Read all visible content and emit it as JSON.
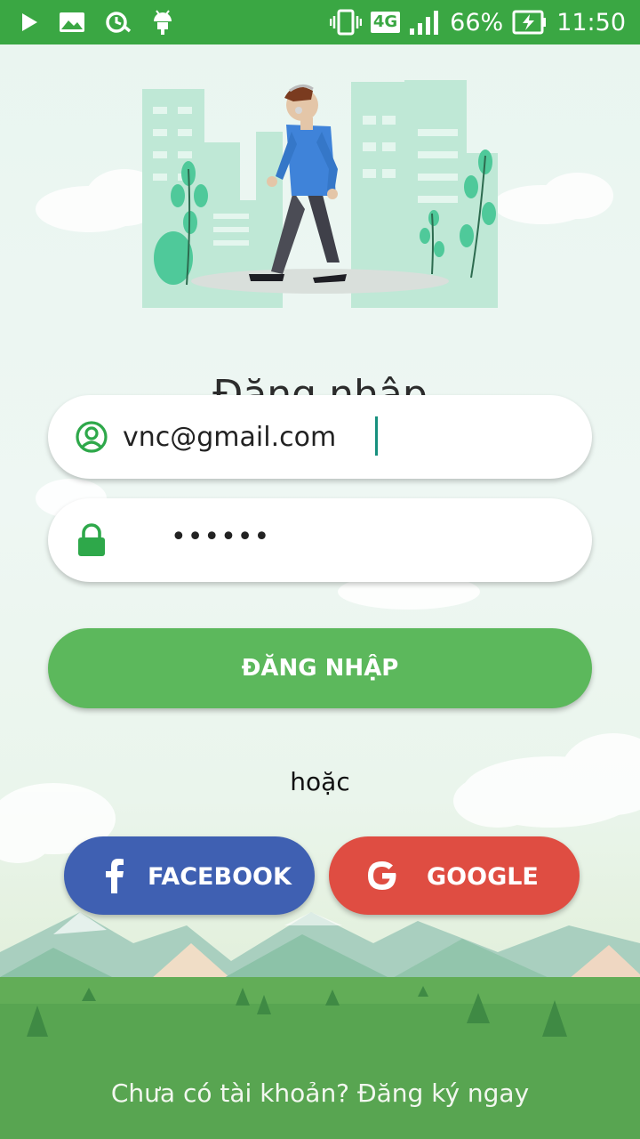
{
  "status_bar": {
    "battery": "66%",
    "time": "11:50",
    "network": "4G",
    "icons": [
      "play-store-icon",
      "image-icon",
      "sync-icon",
      "android-icon",
      "vibrate-icon",
      "network-4g-icon",
      "signal-icon",
      "battery-charging-icon"
    ]
  },
  "login": {
    "title": "Đăng nhập",
    "email_value": "vnc@gmail.com",
    "password_value": "••••••",
    "submit_label": "ĐĂNG NHẬP",
    "or_label": "hoặc",
    "facebook_label": "FACEBOOK",
    "google_label": "GOOGLE",
    "signup_prompt": "Chưa có tài khoản? Đăng ký ngay"
  },
  "colors": {
    "status_bar": "#3aa743",
    "primary_green": "#5cb85c",
    "facebook_blue": "#3f60b2",
    "google_red": "#df4d42",
    "icon_green": "#2ea84a"
  }
}
